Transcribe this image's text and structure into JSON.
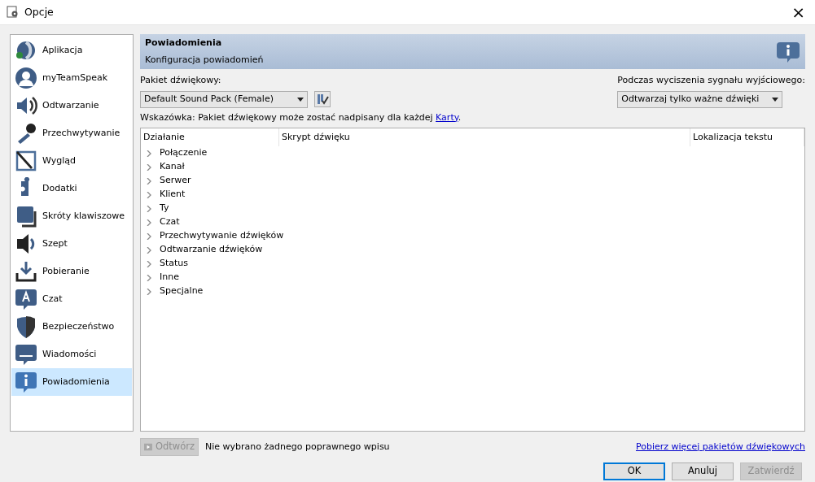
{
  "window": {
    "title": "Opcje",
    "close": "×"
  },
  "sidebar": {
    "items": [
      {
        "label": "Aplikacja",
        "selected": false
      },
      {
        "label": "myTeamSpeak",
        "selected": false
      },
      {
        "label": "Odtwarzanie",
        "selected": false
      },
      {
        "label": "Przechwytywanie",
        "selected": false
      },
      {
        "label": "Wygląd",
        "selected": false
      },
      {
        "label": "Dodatki",
        "selected": false
      },
      {
        "label": "Skróty klawiszowe",
        "selected": false
      },
      {
        "label": "Szept",
        "selected": false
      },
      {
        "label": "Pobieranie",
        "selected": false
      },
      {
        "label": "Czat",
        "selected": false
      },
      {
        "label": "Bezpieczeństwo",
        "selected": false
      },
      {
        "label": "Wiadomości",
        "selected": false
      },
      {
        "label": "Powiadomienia",
        "selected": true
      }
    ]
  },
  "header": {
    "title": "Powiadomienia",
    "subtitle": "Konfiguracja powiadomień"
  },
  "sound_pack": {
    "label": "Pakiet dźwiękowy:",
    "value": "Default Sound Pack (Female)"
  },
  "muted_output": {
    "label": "Podczas wyciszenia sygnału wyjściowego:",
    "value": "Odtwarzaj tylko ważne dźwięki"
  },
  "hint": {
    "text": "Wskazówka: Pakiet dźwiękowy może zostać nadpisany dla każdej",
    "link": "Karty",
    "end": "."
  },
  "table": {
    "columns": [
      "Działanie",
      "Skrypt dźwięku",
      "Lokalizacja tekstu"
    ],
    "rows": [
      {
        "label": "Połączenie",
        "expanded": false
      },
      {
        "label": "Kanał",
        "expanded": false
      },
      {
        "label": "Serwer",
        "expanded": false
      },
      {
        "label": "Klient",
        "expanded": false
      },
      {
        "label": "Ty",
        "expanded": false
      },
      {
        "label": "Czat",
        "expanded": false
      },
      {
        "label": "Przechwytywanie dźwięków",
        "expanded": false
      },
      {
        "label": "Odtwarzanie dźwięków",
        "expanded": false
      },
      {
        "label": "Status",
        "expanded": false
      },
      {
        "label": "Inne",
        "expanded": false
      },
      {
        "label": "Specjalne",
        "expanded": false
      }
    ]
  },
  "play_button": {
    "label": "Odtwórz",
    "disabled": true
  },
  "status": "Nie wybrano żadnego poprawnego wpisu",
  "more_link": "Pobierz więcej pakietów dźwiękowych",
  "buttons": [
    {
      "label": "OK",
      "disabled": false,
      "default": true
    },
    {
      "label": "Anuluj",
      "disabled": false,
      "default": false
    },
    {
      "label": "Zatwierdź",
      "disabled": true,
      "default": false
    }
  ]
}
